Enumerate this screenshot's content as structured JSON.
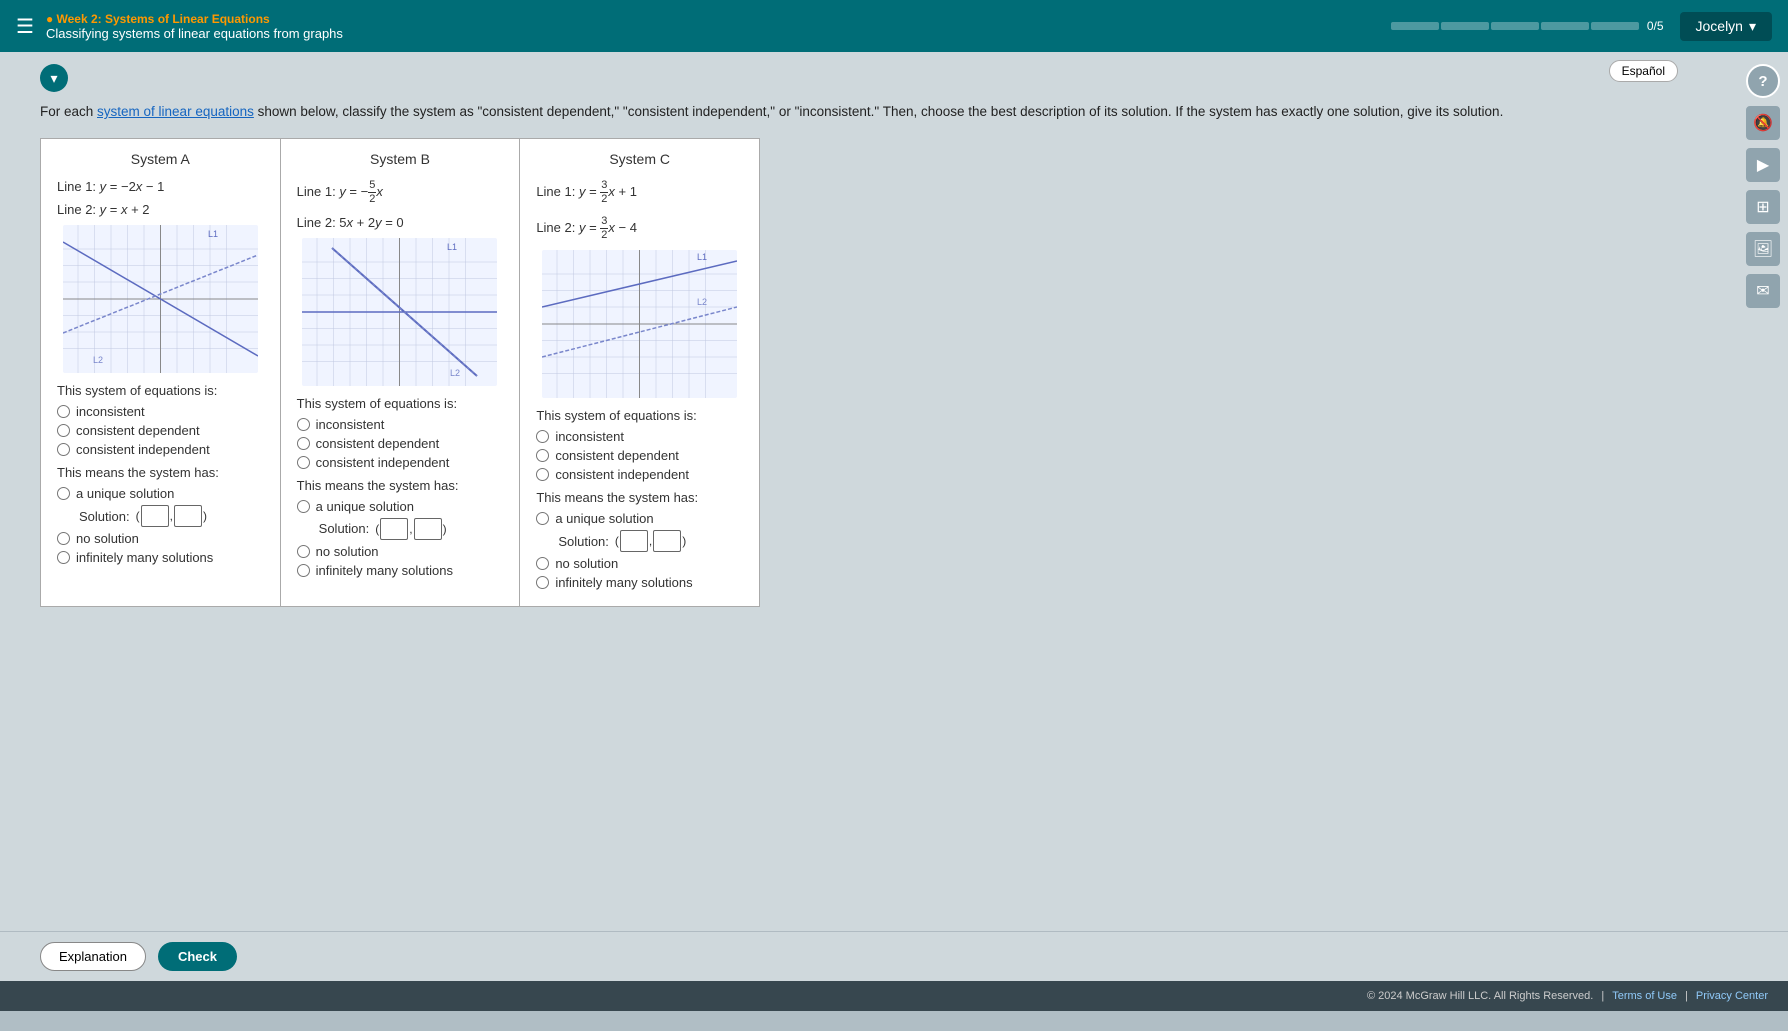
{
  "header": {
    "menu_icon": "☰",
    "week_label": "● Week 2: Systems of Linear Equations",
    "course_label": "Classifying systems of linear equations from graphs",
    "progress_total": 5,
    "progress_done": 0,
    "progress_label": "0/5",
    "user_label": "Jocelyn",
    "espanol_label": "Español"
  },
  "question": {
    "text_prefix": "For each ",
    "link_text": "system of linear equations",
    "text_suffix": " shown below, classify the system as \"consistent dependent,\" \"consistent independent,\" or \"inconsistent.\" Then, choose the best description of its solution. If the system has exactly one solution, give its solution."
  },
  "systems": [
    {
      "id": "A",
      "title": "System A",
      "line1": "Line 1: y = −2x − 1",
      "line2": "Line 2: y = x + 2"
    },
    {
      "id": "B",
      "title": "System B",
      "line1_text": "Line 1: y = −",
      "line1_frac_num": "5",
      "line1_frac_den": "2",
      "line1_suffix": "x",
      "line2": "Line 2: 5x + 2y = 0"
    },
    {
      "id": "C",
      "title": "System C",
      "line1_text": "Line 1: y = ",
      "line1_frac_num": "3",
      "line1_frac_den": "2",
      "line1_suffix": "x + 1",
      "line2_text": "Line 2: y = ",
      "line2_frac_num": "3",
      "line2_frac_den": "2",
      "line2_suffix": "x − 4"
    }
  ],
  "radio_labels": {
    "system_is": "This system of equations is:",
    "inconsistent": "inconsistent",
    "consistent_dependent": "consistent dependent",
    "consistent_independent": "consistent independent",
    "means": "This means the system has:",
    "unique": "a unique solution",
    "solution_label": "Solution:",
    "no_solution": "no solution",
    "infinitely": "infinitely many solutions"
  },
  "buttons": {
    "explanation": "Explanation",
    "check": "Check"
  },
  "footer": {
    "copyright": "© 2024 McGraw Hill LLC. All Rights Reserved.",
    "terms": "Terms of Use",
    "privacy": "Privacy Center"
  },
  "sidebar_icons": [
    "?",
    "🔕",
    "▶",
    "⊞",
    "🖼",
    "✉"
  ]
}
